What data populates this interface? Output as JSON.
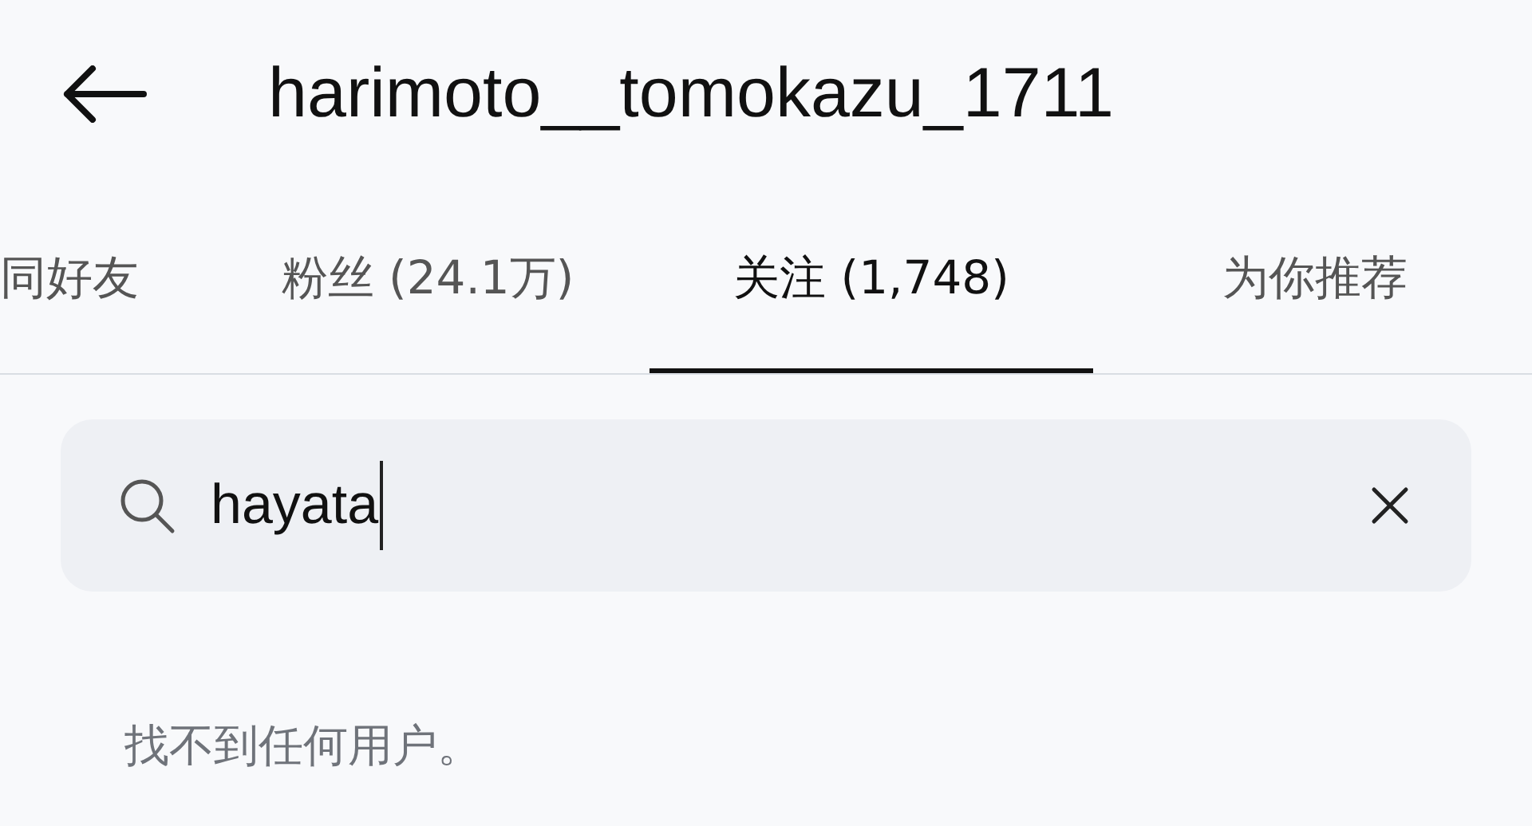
{
  "header": {
    "title": "harimoto__tomokazu_1711"
  },
  "tabs": [
    {
      "label": "同好友",
      "selected": false
    },
    {
      "label": "粉丝 (24.1万)",
      "selected": false
    },
    {
      "label": "关注 (1,748)",
      "selected": true
    },
    {
      "label": "为你推荐",
      "selected": false
    }
  ],
  "search": {
    "value": "hayata",
    "focused": true
  },
  "empty_message": "找不到任何用户。"
}
